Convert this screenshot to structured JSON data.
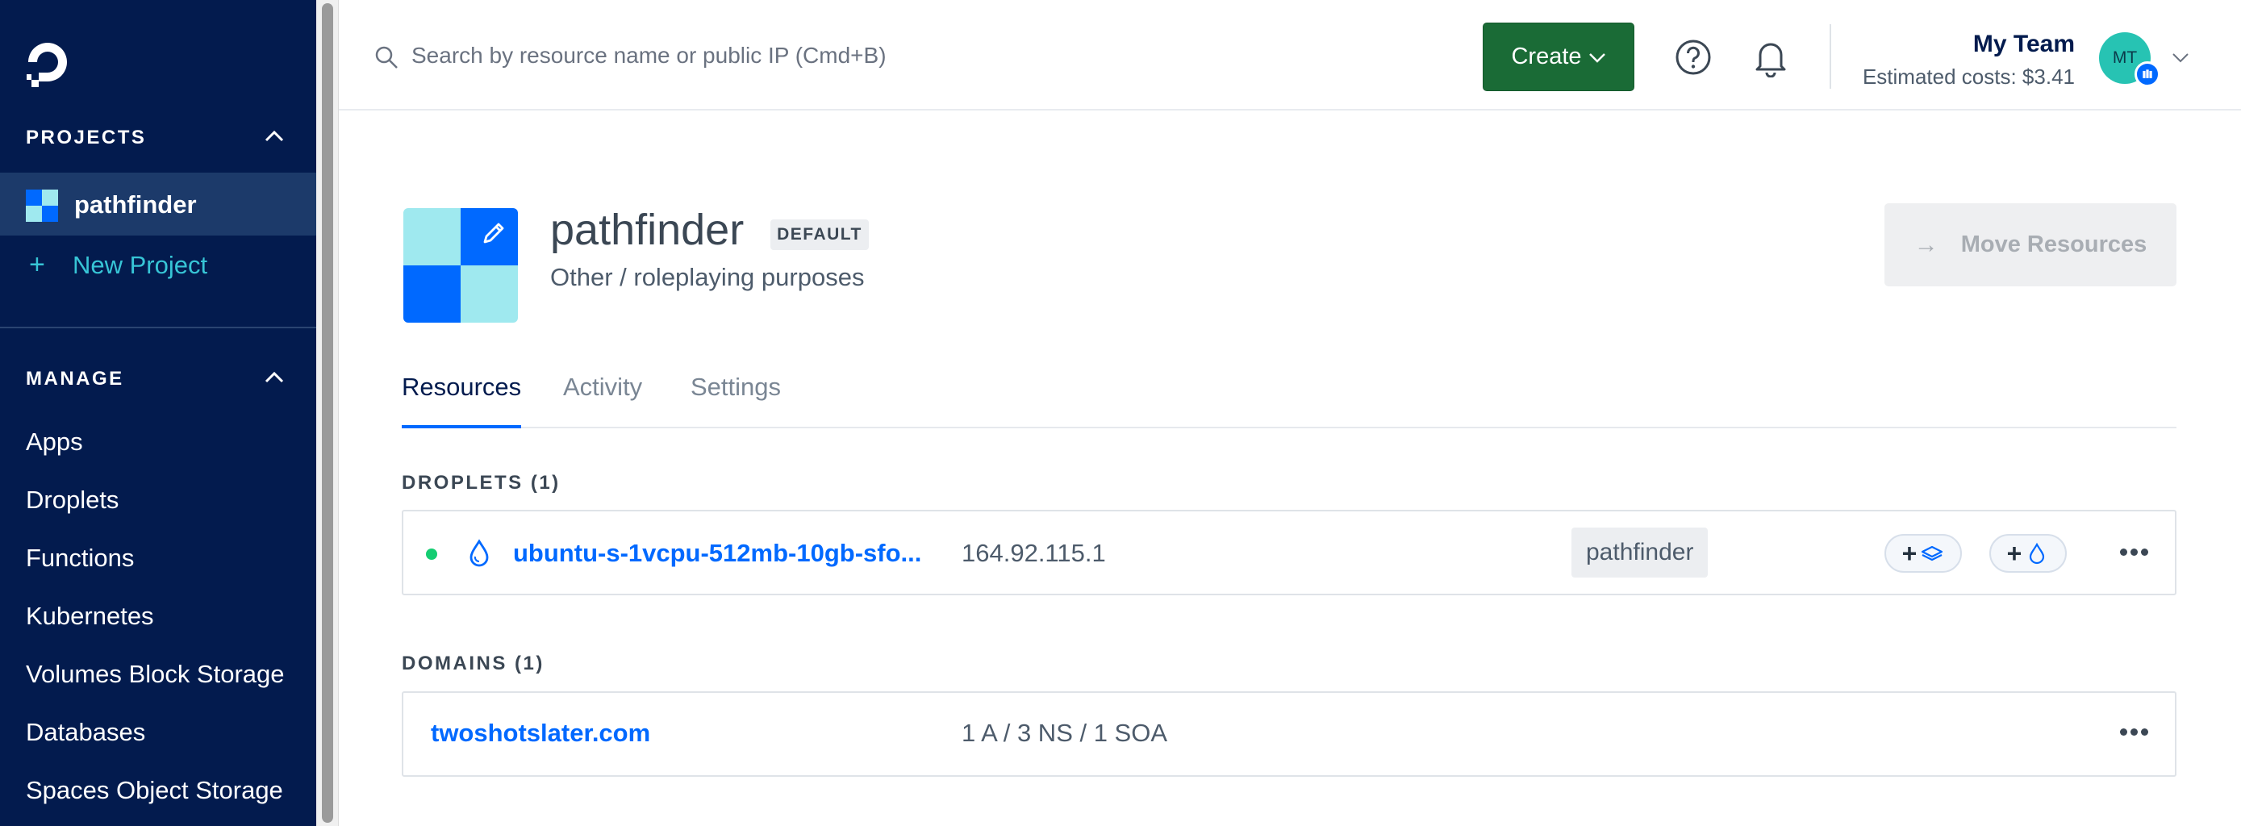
{
  "sidebar": {
    "projects_heading": "PROJECTS",
    "active_project": "pathfinder",
    "new_project": "New Project",
    "manage_heading": "MANAGE",
    "items": [
      {
        "label": "Apps"
      },
      {
        "label": "Droplets"
      },
      {
        "label": "Functions"
      },
      {
        "label": "Kubernetes"
      },
      {
        "label": "Volumes Block Storage"
      },
      {
        "label": "Databases"
      },
      {
        "label": "Spaces Object Storage"
      }
    ]
  },
  "topbar": {
    "search_placeholder": "Search by resource name or public IP (Cmd+B)",
    "create_label": "Create",
    "team_name": "My Team",
    "estimated_costs": "Estimated costs: $3.41",
    "avatar_initials": "MT"
  },
  "project": {
    "name": "pathfinder",
    "badge": "DEFAULT",
    "description": "Other / roleplaying purposes",
    "move_label": "Move Resources"
  },
  "tabs": [
    {
      "label": "Resources",
      "active": true
    },
    {
      "label": "Activity",
      "active": false
    },
    {
      "label": "Settings",
      "active": false
    }
  ],
  "droplets": {
    "heading": "DROPLETS (1)",
    "rows": [
      {
        "name": "ubuntu-s-1vcpu-512mb-10gb-sfo...",
        "ip": "164.92.115.1",
        "tag": "pathfinder",
        "status": "active"
      }
    ]
  },
  "domains": {
    "heading": "DOMAINS (1)",
    "rows": [
      {
        "name": "twoshotslater.com",
        "records": "1 A / 3 NS / 1 SOA"
      }
    ]
  },
  "colors": {
    "sidebar_bg": "#031b4e",
    "sidebar_active": "#1c3a6a",
    "accent": "#0069ff",
    "create_green": "#1a6b36",
    "status_green": "#15cd72",
    "teal": "#37c5d6"
  }
}
